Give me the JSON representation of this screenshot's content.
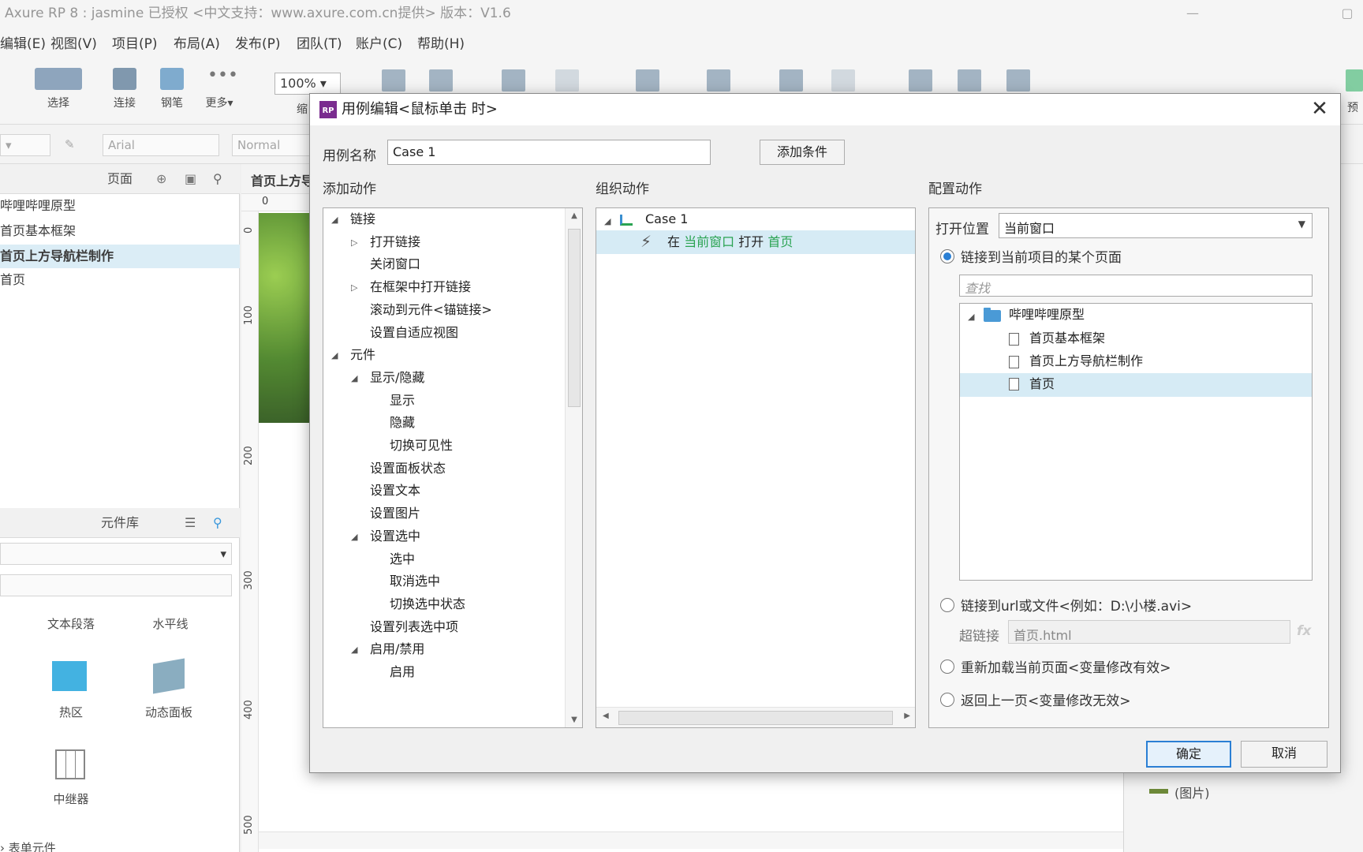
{
  "app": {
    "title": "Axure RP 8 : jasmine 已授权     <中文支持：www.axure.com.cn提供> 版本：V1.6",
    "menu": [
      "编辑(E)",
      "视图(V)",
      "项目(P)",
      "布局(A)",
      "发布(P)",
      "团队(T)",
      "账户(C)",
      "帮助(H)"
    ],
    "tools": [
      "选择",
      "连接",
      "钢笔",
      "更多▾"
    ],
    "zoom": "100%",
    "zoom_label": "缩",
    "preview_label": "预",
    "font_select": "Arial",
    "style_select": "Normal",
    "pages_panel": {
      "title": "页面",
      "items": [
        "哔哩哔哩原型",
        "首页基本框架",
        "首页上方导航栏制作",
        "首页"
      ],
      "active_index": 2
    },
    "library_panel": {
      "title": "元件库",
      "widgets": [
        "文本段落",
        "水平线",
        "热区",
        "动态面板",
        "中继器"
      ],
      "footer": "表单元件"
    },
    "canvas_tab": "首页上方导",
    "ruler": {
      "top": [
        "0"
      ],
      "left": [
        "0",
        "100",
        "200",
        "300",
        "400",
        "500"
      ]
    },
    "right_panel": {
      "items": [
        "(图片)"
      ]
    }
  },
  "dialog": {
    "title": "用例编辑<鼠标单击 时>",
    "case_name_label": "用例名称",
    "case_name_value": "Case 1",
    "add_condition_label": "添加条件",
    "add_action": {
      "header": "添加动作",
      "tree": [
        {
          "text": "链接",
          "level": 0,
          "expander": "open"
        },
        {
          "text": "打开链接",
          "level": 1,
          "expander": "closed"
        },
        {
          "text": "关闭窗口",
          "level": 1,
          "expander": ""
        },
        {
          "text": "在框架中打开链接",
          "level": 1,
          "expander": "closed"
        },
        {
          "text": "滚动到元件<锚链接>",
          "level": 1,
          "expander": ""
        },
        {
          "text": "设置自适应视图",
          "level": 1,
          "expander": ""
        },
        {
          "text": "元件",
          "level": 0,
          "expander": "open"
        },
        {
          "text": "显示/隐藏",
          "level": 1,
          "expander": "open"
        },
        {
          "text": "显示",
          "level": 2,
          "expander": ""
        },
        {
          "text": "隐藏",
          "level": 2,
          "expander": ""
        },
        {
          "text": "切换可见性",
          "level": 2,
          "expander": ""
        },
        {
          "text": "设置面板状态",
          "level": 1,
          "expander": ""
        },
        {
          "text": "设置文本",
          "level": 1,
          "expander": ""
        },
        {
          "text": "设置图片",
          "level": 1,
          "expander": ""
        },
        {
          "text": "设置选中",
          "level": 1,
          "expander": "open"
        },
        {
          "text": "选中",
          "level": 2,
          "expander": ""
        },
        {
          "text": "取消选中",
          "level": 2,
          "expander": ""
        },
        {
          "text": "切换选中状态",
          "level": 2,
          "expander": ""
        },
        {
          "text": "设置列表选中项",
          "level": 1,
          "expander": ""
        },
        {
          "text": "启用/禁用",
          "level": 1,
          "expander": "open"
        },
        {
          "text": "启用",
          "level": 2,
          "expander": ""
        }
      ]
    },
    "organize": {
      "header": "组织动作",
      "case_label": "Case 1",
      "action_prefix": "在",
      "action_target": "当前窗口",
      "action_verb": "打开",
      "action_page": "首页"
    },
    "configure": {
      "header": "配置动作",
      "open_location_label": "打开位置",
      "open_location_value": "当前窗口",
      "option_page": "链接到当前项目的某个页面",
      "search_placeholder": "查找",
      "tree_root": "哔哩哔哩原型",
      "tree_pages": [
        "首页基本框架",
        "首页上方导航栏制作",
        "首页"
      ],
      "selected_page_index": 2,
      "option_url": "链接到url或文件<例如：D:\\小楼.avi>",
      "hyperlink_label": "超链接",
      "hyperlink_value": "首页.html",
      "fx_label": "fx",
      "option_reload": "重新加载当前页面<变量修改有效>",
      "option_back": "返回上一页<变量修改无效>",
      "selected_option": "page"
    },
    "ok_label": "确定",
    "cancel_label": "取消"
  },
  "colors": {
    "accent": "#2a7fd4",
    "selection": "#d6ebf5",
    "action_green": "#2aa352"
  }
}
